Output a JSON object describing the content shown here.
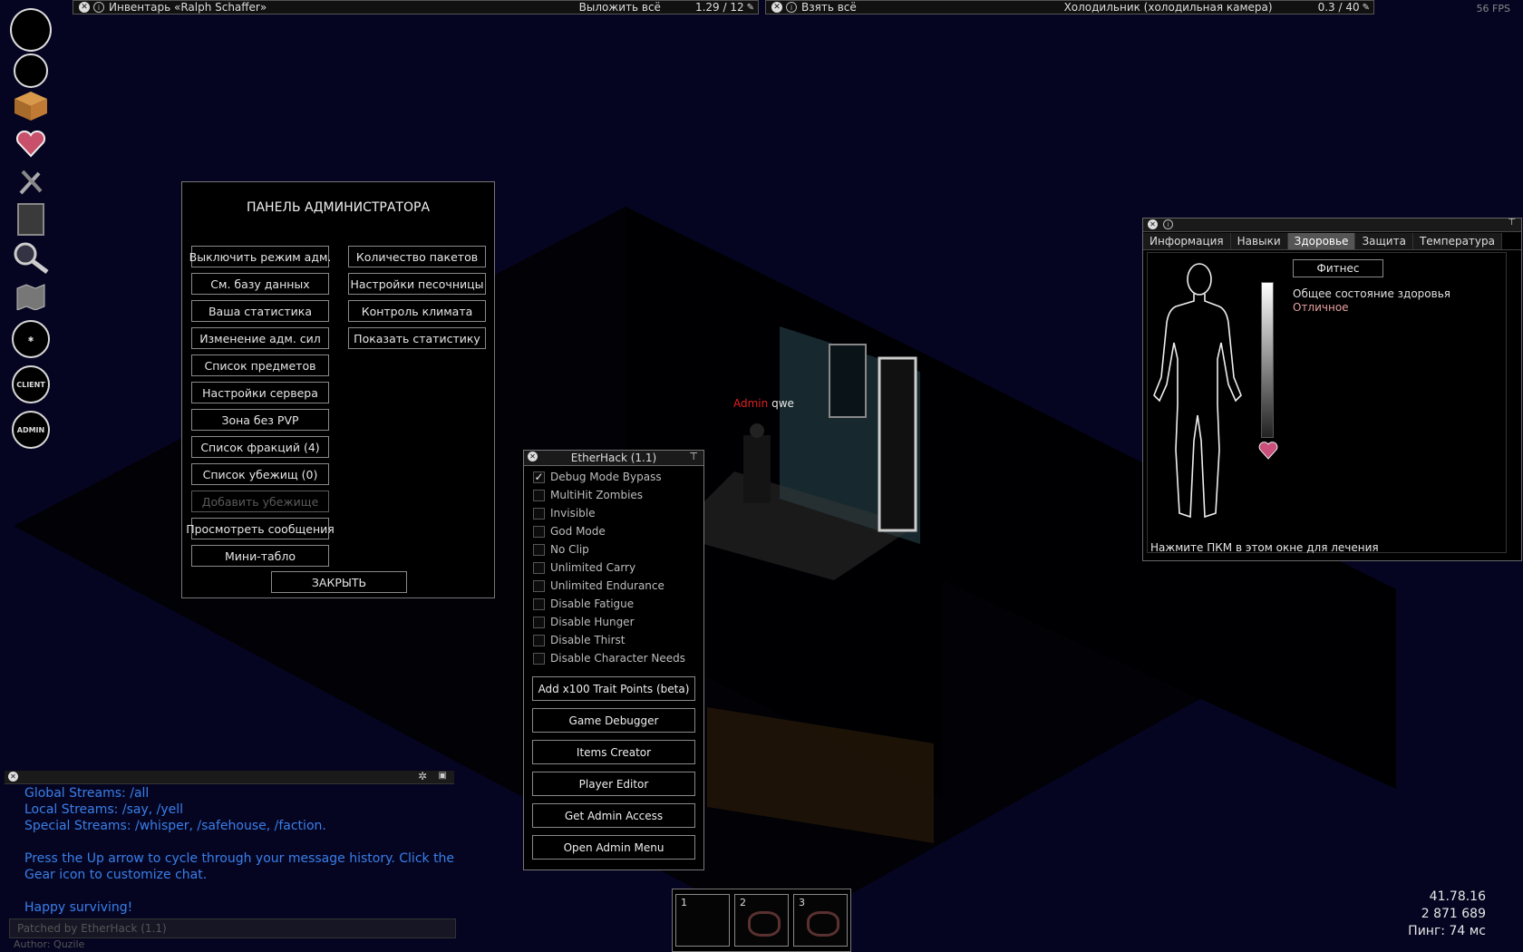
{
  "fps": "56 FPS",
  "top_left_bar": {
    "close": "x",
    "title": "Инвентарь «Ralph Schaffer»",
    "action": "Выложить всё",
    "weight": "1.29 / 12"
  },
  "top_right_bar": {
    "close": "x",
    "action": "Взять всё",
    "container": "Холодильник (холодильная камера)",
    "weight": "0.3 / 40"
  },
  "sidebar": {
    "client_label": "CLIENT",
    "admin_label": "ADMIN",
    "icons": [
      "circle-icon",
      "circle-icon",
      "box-icon",
      "heart-icon",
      "tools-icon",
      "furnace-icon",
      "magnifier-icon",
      "map-icon",
      "mosquito-icon",
      "client-icon",
      "admin-icon"
    ]
  },
  "admin_panel": {
    "title": "ПАНЕЛЬ АДМИНИСТРАТОРА",
    "left_buttons": [
      "Выключить режим адм.",
      "См. базу данных",
      "Ваша статистика",
      "Изменение адм. сил",
      "Список предметов",
      "Настройки сервера",
      "Зона без PVP",
      "Список фракций (4)",
      "Список убежищ (0)",
      "Добавить убежище",
      "Просмотреть сообщения",
      "Мини-табло"
    ],
    "disabled_index": 9,
    "right_buttons": [
      "Количество пакетов",
      "Настройки песочницы",
      "Контроль климата",
      "Показать статистику"
    ],
    "close_label": "ЗАКРЫТЬ"
  },
  "player_tag": {
    "role": "Admin",
    "name": "qwe",
    "role_color": "#e02020"
  },
  "etherhack": {
    "title": "EtherHack (1.1)",
    "options": [
      {
        "label": "Debug Mode Bypass",
        "checked": true
      },
      {
        "label": "MultiHit Zombies",
        "checked": false
      },
      {
        "label": "Invisible",
        "checked": false
      },
      {
        "label": "God Mode",
        "checked": false
      },
      {
        "label": "No Clip",
        "checked": false
      },
      {
        "label": "Unlimited Carry",
        "checked": false
      },
      {
        "label": "Unlimited Endurance",
        "checked": false
      },
      {
        "label": "Disable Fatigue",
        "checked": false
      },
      {
        "label": "Disable Hunger",
        "checked": false
      },
      {
        "label": "Disable Thirst",
        "checked": false
      },
      {
        "label": "Disable Character Needs",
        "checked": false
      }
    ],
    "buttons": [
      "Add x100 Trait Points (beta)",
      "Game Debugger",
      "Items Creator",
      "Player Editor",
      "Get Admin Access",
      "Open Admin Menu"
    ]
  },
  "health_window": {
    "tabs": [
      "Информация",
      "Навыки",
      "Здоровье",
      "Защита",
      "Температура"
    ],
    "active_tab": 2,
    "fitness_button": "Фитнес",
    "overall_label": "Общее состояние здоровья",
    "overall_value": "Отличное",
    "overall_value_color": "#e8a0a0",
    "hint": "Нажмите ПКМ в этом окне для лечения"
  },
  "chat": {
    "lines": [
      "Global Streams: /all",
      "Local Streams: /say, /yell",
      "Special Streams: /whisper, /safehouse, /faction.",
      "",
      "Press the Up arrow to cycle through your message history. Click the",
      "Gear icon to customize chat.",
      "",
      "Happy surviving!"
    ],
    "input_text": "Patched by EtherHack (1.1)",
    "author_text": "Author: Quzile"
  },
  "hotbar": {
    "slots": [
      "1",
      "2",
      "3"
    ]
  },
  "stats": {
    "coords": "41.78.16",
    "money": "2 871 689",
    "ping": "Пинг: 74 мс"
  }
}
